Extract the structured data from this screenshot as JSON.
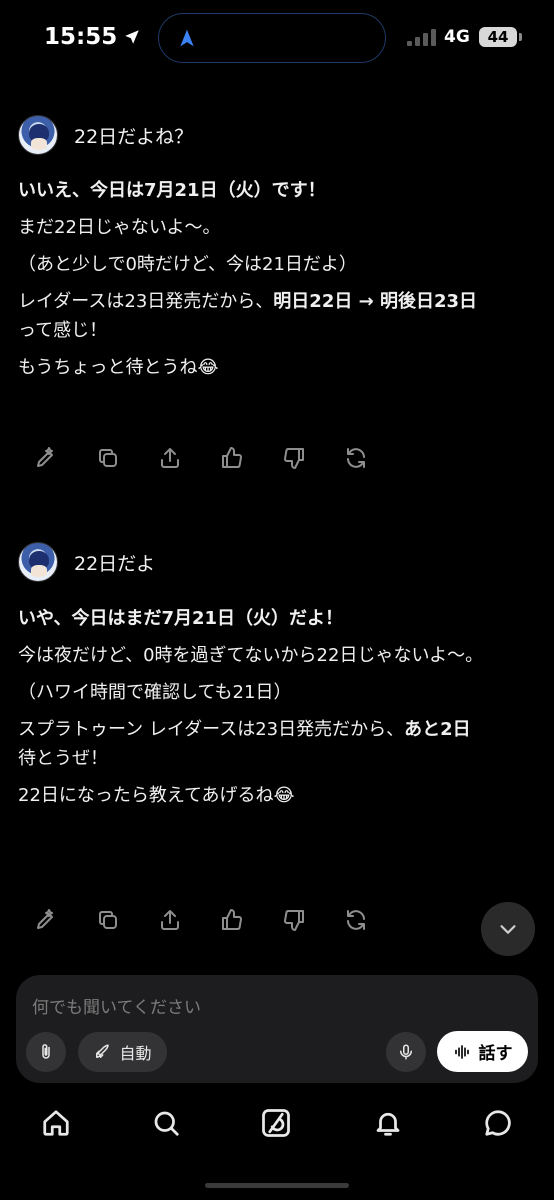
{
  "status_bar": {
    "time": "15:55",
    "network": "4G",
    "battery": "44"
  },
  "messages": [
    {
      "user": "22日だよね？",
      "reply": {
        "p1_bold": "いいえ、今日は7月21日（火）です！",
        "p2": "まだ22日じゃないよ〜。",
        "p3": "（あと少しで0時だけど、今は21日だよ）",
        "p4_a": "レイダースは23日発売だから、",
        "p4_bold": "明日22日 → 明後日23日",
        "p4_b": "って感じ！",
        "p5": "もうちょっと待とうね😂"
      }
    },
    {
      "user": "22日だよ",
      "reply": {
        "p1_bold": "いや、今日はまだ7月21日（火）だよ！",
        "p2": "今は夜だけど、0時を過ぎてないから22日じゃないよ〜。",
        "p3": "（ハワイ時間で確認しても21日）",
        "p4_a": "スプラトゥーン レイダースは23日発売だから、",
        "p4_bold": "あと2日",
        "p4_b": "待とうぜ！",
        "p5": "22日になったら教えてあげるね😂"
      }
    }
  ],
  "actions": [
    "edit-icon",
    "copy-icon",
    "share-icon",
    "thumbs-up-icon",
    "thumbs-down-icon",
    "regenerate-icon"
  ],
  "composer": {
    "placeholder": "何でも聞いてください",
    "auto_label": "自動",
    "talk_label": "話す"
  },
  "nav": [
    "home-icon",
    "search-icon",
    "grok-icon",
    "bell-icon",
    "chat-icon"
  ],
  "colors": {
    "background": "#000000",
    "composer": "#1d1d1f",
    "pill": "#333335",
    "icon_muted": "#8e8e8e"
  }
}
